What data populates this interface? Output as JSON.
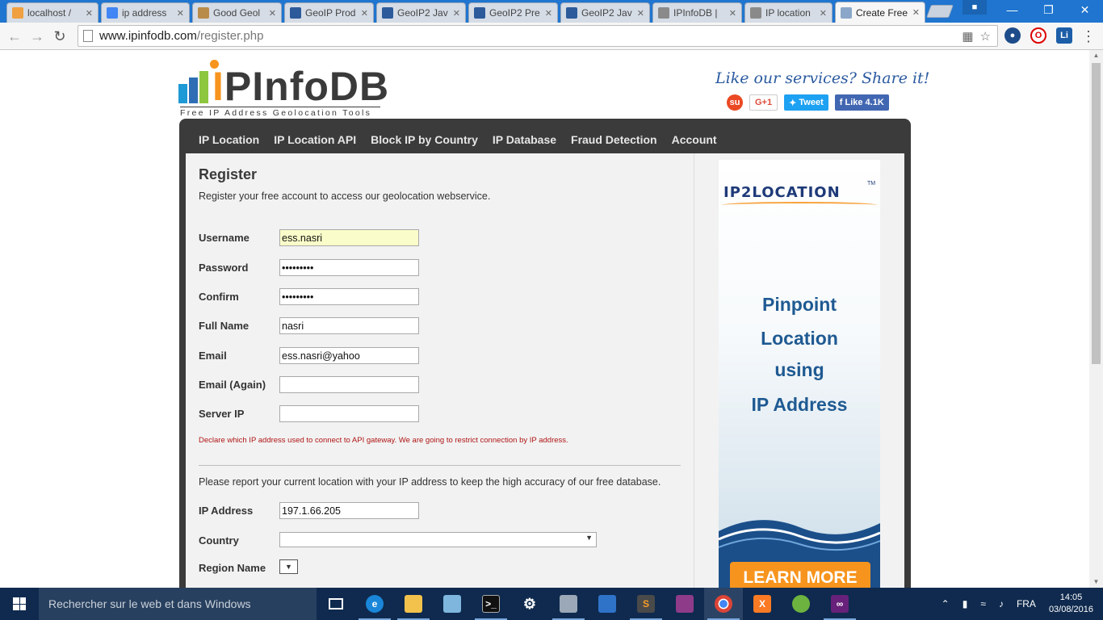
{
  "browser": {
    "tabs": [
      {
        "title": "localhost / ",
        "favicon": "phpmyadmin-icon",
        "color": "#f0a040"
      },
      {
        "title": "ip address",
        "favicon": "google-icon",
        "color": "#4285f4"
      },
      {
        "title": "Good Geol",
        "favicon": "bookmark-icon",
        "color": "#b98b4a"
      },
      {
        "title": "GeoIP Prod",
        "favicon": "maxmind-icon",
        "color": "#2c5a9a"
      },
      {
        "title": "GeoIP2 Jav",
        "favicon": "maxmind-icon",
        "color": "#2c5a9a"
      },
      {
        "title": "GeoIP2 Pre",
        "favicon": "maxmind-icon",
        "color": "#2c5a9a"
      },
      {
        "title": "GeoIP2 Jav",
        "favicon": "maxmind-icon",
        "color": "#2c5a9a"
      },
      {
        "title": "IPInfoDB |",
        "favicon": "page-icon",
        "color": "#8a8a8a"
      },
      {
        "title": "IP location",
        "favicon": "page-icon",
        "color": "#8a8a8a"
      },
      {
        "title": "Create Free",
        "favicon": "ipinfodb-icon",
        "color": "#8aa7c9"
      }
    ],
    "url_host": "www.ipinfodb.com",
    "url_path": "/register.php"
  },
  "site": {
    "logo_main": "PInfoDB",
    "logo_tagline": "Free IP Address Geolocation Tools",
    "share_title": "Like our services? Share it!",
    "share_buttons": {
      "gplus": "G+1",
      "tweet": "Tweet",
      "like": "Like 4.1K"
    },
    "menu": [
      "IP Location",
      "IP Location API",
      "Block IP by Country",
      "IP Database",
      "Fraud Detection",
      "Account"
    ]
  },
  "form": {
    "heading": "Register",
    "intro": "Register your free account to access our geolocation webservice.",
    "fields": [
      {
        "label": "Username",
        "value": "ess.nasri"
      },
      {
        "label": "Password",
        "value": "•••••••••"
      },
      {
        "label": "Confirm",
        "value": "•••••••••"
      },
      {
        "label": "Full Name",
        "value": "nasri"
      },
      {
        "label": "Email",
        "value": "ess.nasri@yahoo"
      },
      {
        "label": "Email (Again)",
        "value": ""
      },
      {
        "label": "Server IP",
        "value": ""
      }
    ],
    "notice": "Declare which IP address used to connect to API gateway. We are going to restrict connection by IP address.",
    "report_text": "Please report your current location with your IP address to keep the high accuracy of our free database.",
    "ip_label": "IP Address",
    "ip_value": "197.1.66.205",
    "country_label": "Country",
    "country_value": "",
    "region_label": "Region Name"
  },
  "ad": {
    "brand": "IP2LOCATION",
    "tm": "TM",
    "lines": [
      "Pinpoint",
      "Location",
      "using",
      "IP Address"
    ],
    "cta": "LEARN MORE"
  },
  "taskbar": {
    "search_placeholder": "Rechercher sur le web et dans Windows",
    "lang": "FRA",
    "time": "14:05",
    "date": "03/08/2016"
  }
}
